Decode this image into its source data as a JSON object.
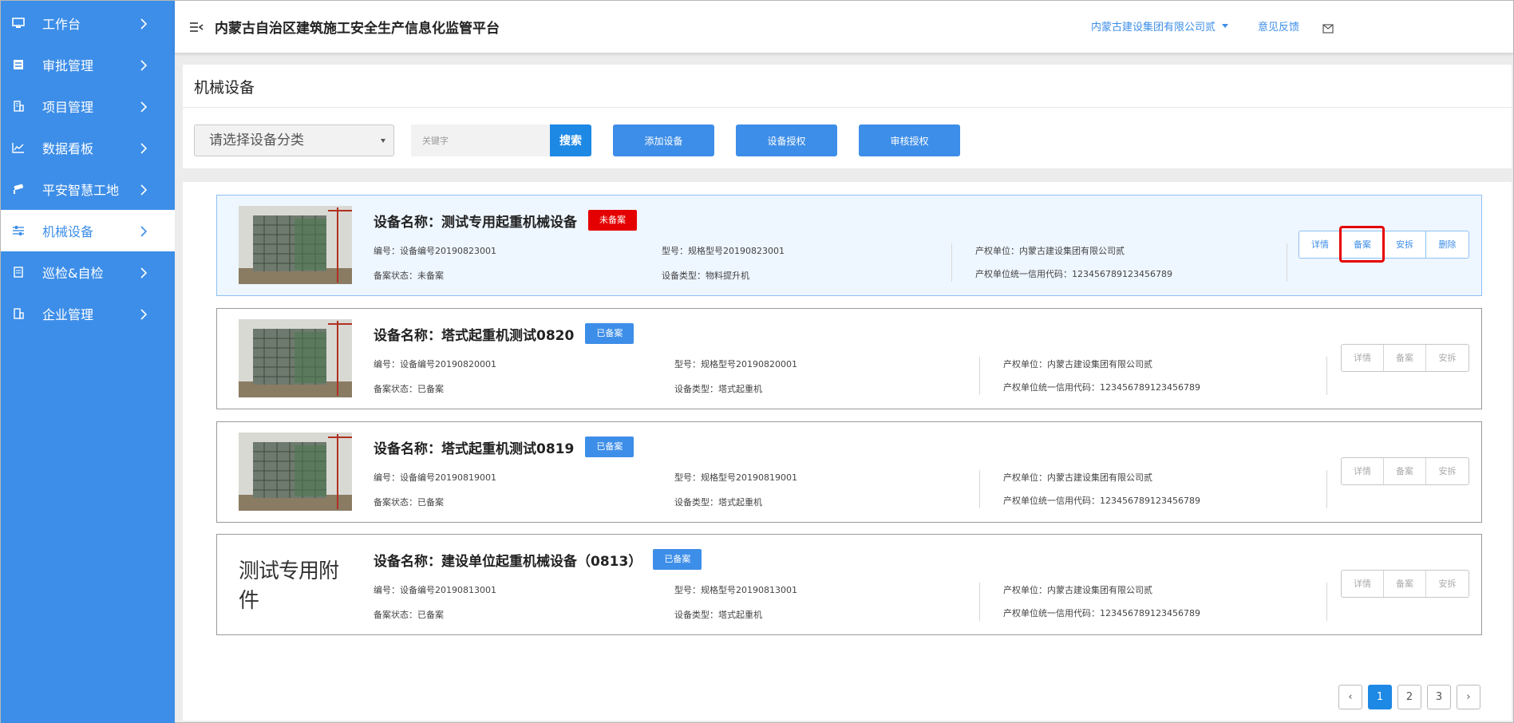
{
  "sidebar": {
    "items": [
      {
        "label": "工作台",
        "icon": "monitor-icon"
      },
      {
        "label": "审批管理",
        "icon": "approval-icon"
      },
      {
        "label": "项目管理",
        "icon": "building-icon"
      },
      {
        "label": "数据看板",
        "icon": "chart-icon"
      },
      {
        "label": "平安智慧工地",
        "icon": "camera-icon"
      },
      {
        "label": "机械设备",
        "icon": "machine-icon",
        "active": true
      },
      {
        "label": "巡检&自检",
        "icon": "clipboard-icon"
      },
      {
        "label": "企业管理",
        "icon": "enterprise-icon"
      }
    ]
  },
  "header": {
    "title": "内蒙古自治区建筑施工安全生产信息化监管平台",
    "company": "内蒙古建设集团有限公司贰",
    "feedback": "意见反馈"
  },
  "page": {
    "title": "机械设备",
    "category_select": "请选择设备分类",
    "keyword_placeholder": "关键字",
    "search_label": "搜索",
    "add_label": "添加设备",
    "auth_label": "设备授权",
    "review_label": "审核授权"
  },
  "labels": {
    "name_prefix": "设备名称：",
    "code_prefix": "编号：",
    "status_prefix": "备案状态：",
    "model_prefix": "型号：",
    "type_prefix": "设备类型：",
    "owner_prefix": "产权单位：",
    "credit_prefix": "产权单位统一信用代码：",
    "btn_detail": "详情",
    "btn_record": "备案",
    "btn_dismantle": "安拆",
    "btn_delete": "删除"
  },
  "devices": [
    {
      "name": "测试专用起重机械设备",
      "badge": "未备案",
      "code": "设备编号20190823001",
      "status": "未备案",
      "model": "规格型号20190823001",
      "type": "物料提升机",
      "owner": "内蒙古建设集团有限公司贰",
      "credit": "123456789123456789"
    },
    {
      "name": "塔式起重机测试0820",
      "badge": "已备案",
      "code": "设备编号20190820001",
      "status": "已备案",
      "model": "规格型号20190820001",
      "type": "塔式起重机",
      "owner": "内蒙古建设集团有限公司贰",
      "credit": "123456789123456789"
    },
    {
      "name": "塔式起重机测试0819",
      "badge": "已备案",
      "code": "设备编号20190819001",
      "status": "已备案",
      "model": "规格型号20190819001",
      "type": "塔式起重机",
      "owner": "内蒙古建设集团有限公司贰",
      "credit": "123456789123456789"
    },
    {
      "name": "建设单位起重机械设备（0813）",
      "badge": "已备案",
      "code": "设备编号20190813001",
      "status": "已备案",
      "model": "规格型号20190813001",
      "type": "塔式起重机",
      "owner": "内蒙古建设集团有限公司贰",
      "credit": "123456789123456789",
      "thumb_text": "测试专用附件"
    }
  ],
  "pagination": {
    "pages": [
      "1",
      "2",
      "3"
    ],
    "current": "1",
    "prev": "‹",
    "next": "›"
  },
  "colors": {
    "sidebar": "#3d8ee8",
    "accent": "#1e88e5",
    "danger": "#e50000"
  }
}
